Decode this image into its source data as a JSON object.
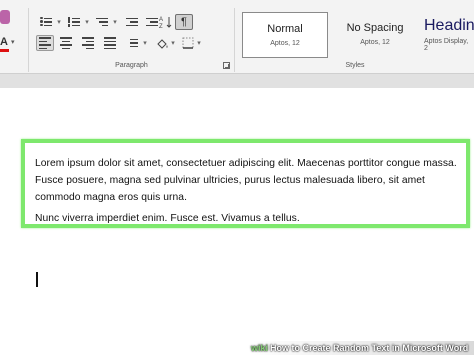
{
  "ribbon": {
    "paragraph_group": {
      "label": "Paragraph"
    },
    "styles_group": {
      "label": "Styles",
      "items": [
        {
          "name": "Normal",
          "font": "Aptos, 12"
        },
        {
          "name": "No Spacing",
          "font": "Aptos, 12"
        },
        {
          "name": "Headin",
          "font": "Aptos Display, 2"
        }
      ]
    }
  },
  "document": {
    "paragraphs": [
      "Lorem ipsum dolor sit amet, consectetuer adipiscing elit. Maecenas porttitor congue massa. Fusce posuere, magna sed pulvinar ultricies, purus lectus malesuada libero, sit amet commodo magna eros quis urna.",
      "Nunc viverra imperdiet enim. Fusce est. Vivamus a tellus."
    ]
  },
  "watermark": {
    "logo": "wiki",
    "text": "How to Create Random Text in Microsoft Word"
  },
  "colors": {
    "highlight_border": "#7ee86d",
    "heading_style": "#1a1a60",
    "font_color_bar": "#dd1111"
  }
}
